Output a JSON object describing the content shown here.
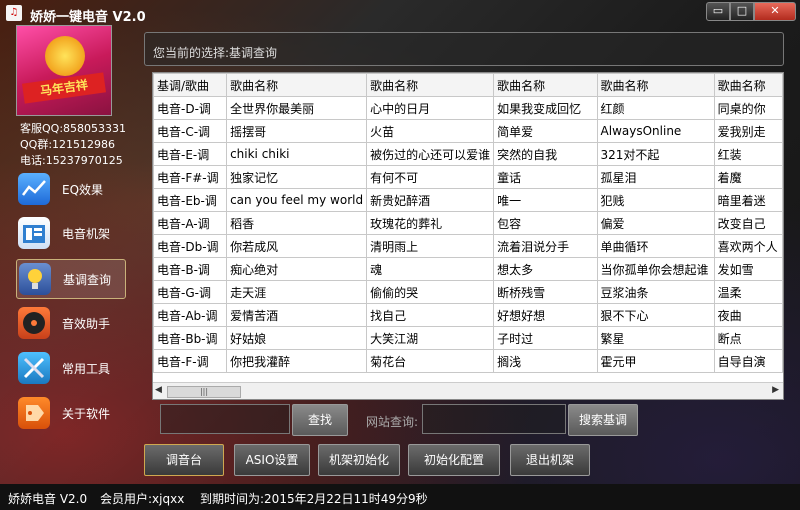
{
  "window": {
    "title": "娇娇一键电音 V2.0"
  },
  "contact": {
    "qq": "客服QQ:858053331",
    "group": "QQ群:121512986",
    "phone": "电话:15237970125"
  },
  "sidebar": {
    "items": [
      {
        "label": "EQ效果",
        "icon": "chart-icon",
        "color": "#3a8de6"
      },
      {
        "label": "电音机架",
        "icon": "rack-icon",
        "color": "#4a90d9"
      },
      {
        "label": "基调查询",
        "icon": "lightbulb-icon",
        "color": "#e8b020",
        "active": true
      },
      {
        "label": "音效助手",
        "icon": "vinyl-icon",
        "color": "#e05a20"
      },
      {
        "label": "常用工具",
        "icon": "tools-icon",
        "color": "#2e9ad8"
      },
      {
        "label": "关于软件",
        "icon": "tag-icon",
        "color": "#e85a10"
      }
    ]
  },
  "selection": {
    "text": "您当前的选择:基调查询"
  },
  "table": {
    "headers": [
      "基调/歌曲",
      "歌曲名称",
      "歌曲名称",
      "歌曲名称",
      "歌曲名称",
      "歌曲名称"
    ],
    "rows": [
      [
        "电音-D-调",
        "全世界你最美丽",
        "心中的日月",
        "如果我变成回忆",
        "红颜",
        "同桌的你"
      ],
      [
        "电音-C-调",
        "摇摆哥",
        "火苗",
        "简单爱",
        "AlwaysOnline",
        "爱我别走"
      ],
      [
        "电音-E-调",
        "chiki chiki",
        "被伤过的心还可以爱谁",
        "突然的自我",
        "321对不起",
        "红装"
      ],
      [
        "电音-F#-调",
        "独家记忆",
        "有何不可",
        "童话",
        "孤星泪",
        "着魔"
      ],
      [
        "电音-Eb-调",
        "can you feel my world",
        "新贵妃醉酒",
        "唯一",
        "犯贱",
        "暗里着迷"
      ],
      [
        "电音-A-调",
        "稻香",
        "玫瑰花的葬礼",
        "包容",
        "偏爱",
        "改变自己"
      ],
      [
        "电音-Db-调",
        "你若成风",
        "清明雨上",
        "流着泪说分手",
        "单曲循环",
        "喜欢两个人"
      ],
      [
        "电音-B-调",
        "痴心绝对",
        "魂",
        "想太多",
        "当你孤单你会想起谁",
        "发如雪"
      ],
      [
        "电音-G-调",
        "走天涯",
        "偷偷的哭",
        "断桥残雪",
        "豆浆油条",
        "温柔"
      ],
      [
        "电音-Ab-调",
        "爱情苦酒",
        "找自己",
        "好想好想",
        "狠不下心",
        "夜曲"
      ],
      [
        "电音-Bb-调",
        "好姑娘",
        "大笑江湖",
        "子时过",
        "繁星",
        "断点"
      ],
      [
        "电音-F-调",
        "你把我灌醉",
        "菊花台",
        "搁浅",
        "霍元甲",
        "自导自演"
      ]
    ]
  },
  "search": {
    "query_button": "查找",
    "site_label": "网站查询:",
    "search_button": "搜索基调"
  },
  "bottom_buttons": [
    "调音台",
    "ASIO设置",
    "机架初始化",
    "初始化配置",
    "退出机架"
  ],
  "status": {
    "app": "娇娇电音 V2.0",
    "user": "会员用户:xjqxx",
    "expire": "到期时间为:2015年2月22日11时49分9秒"
  }
}
